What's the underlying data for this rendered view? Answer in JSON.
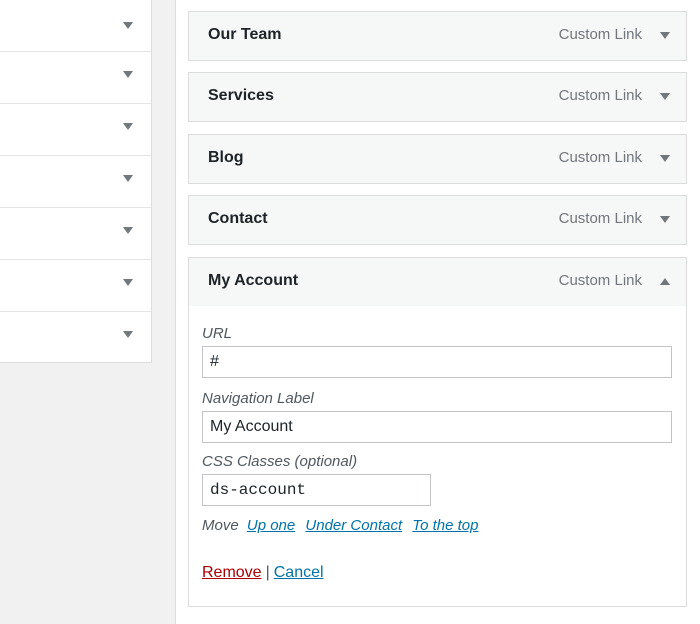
{
  "left_panel": {
    "rows": [
      "",
      "",
      "",
      "",
      "",
      "",
      ""
    ]
  },
  "menu_items": [
    {
      "title": "Our Team",
      "type": "Custom Link"
    },
    {
      "title": "Services",
      "type": "Custom Link"
    },
    {
      "title": "Blog",
      "type": "Custom Link"
    },
    {
      "title": "Contact",
      "type": "Custom Link"
    },
    {
      "title": "My Account",
      "type": "Custom Link"
    }
  ],
  "item_settings": {
    "url_label": "URL",
    "url_value": "#",
    "nav_label_label": "Navigation Label",
    "nav_label_value": "My Account",
    "css_label": "CSS Classes (optional)",
    "css_value": "ds-account",
    "move_label": "Move",
    "move_up": "Up one",
    "move_under": "Under Contact",
    "move_top": "To the top",
    "remove_label": "Remove",
    "separator": "|",
    "cancel_label": "Cancel"
  },
  "colors": {
    "link": "#0073aa",
    "remove": "#aa0000"
  }
}
